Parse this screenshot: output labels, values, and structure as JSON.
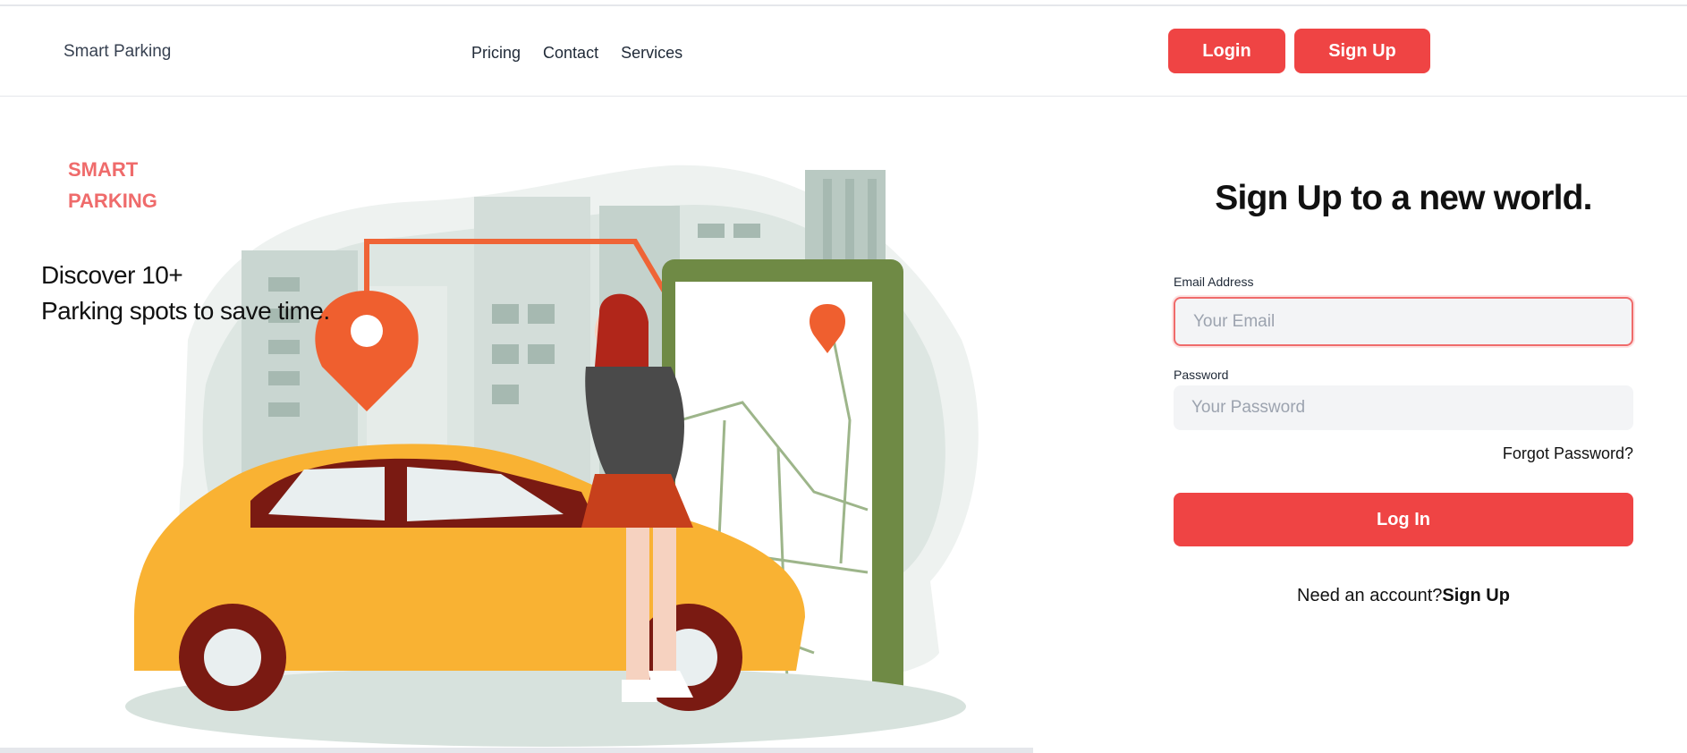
{
  "header": {
    "brand": "Smart Parking",
    "nav": [
      "Pricing",
      "Contact",
      "Services"
    ],
    "login_label": "Login",
    "signup_label": "Sign Up"
  },
  "hero": {
    "label_line1": "SMART",
    "label_line2": "PARKING",
    "text_line1": "Discover 10+",
    "text_line2": "Parking spots to save time."
  },
  "form": {
    "title": "Sign Up to a new world.",
    "email_label": "Email Address",
    "email_placeholder": "Your Email",
    "password_label": "Password",
    "password_placeholder": "Your Password",
    "forgot": "Forgot Password?",
    "submit": "Log In",
    "need_account": "Need an account?",
    "signup_link": "Sign Up"
  },
  "colors": {
    "accent": "#ef4444",
    "brand_label": "#ef6b6b"
  }
}
